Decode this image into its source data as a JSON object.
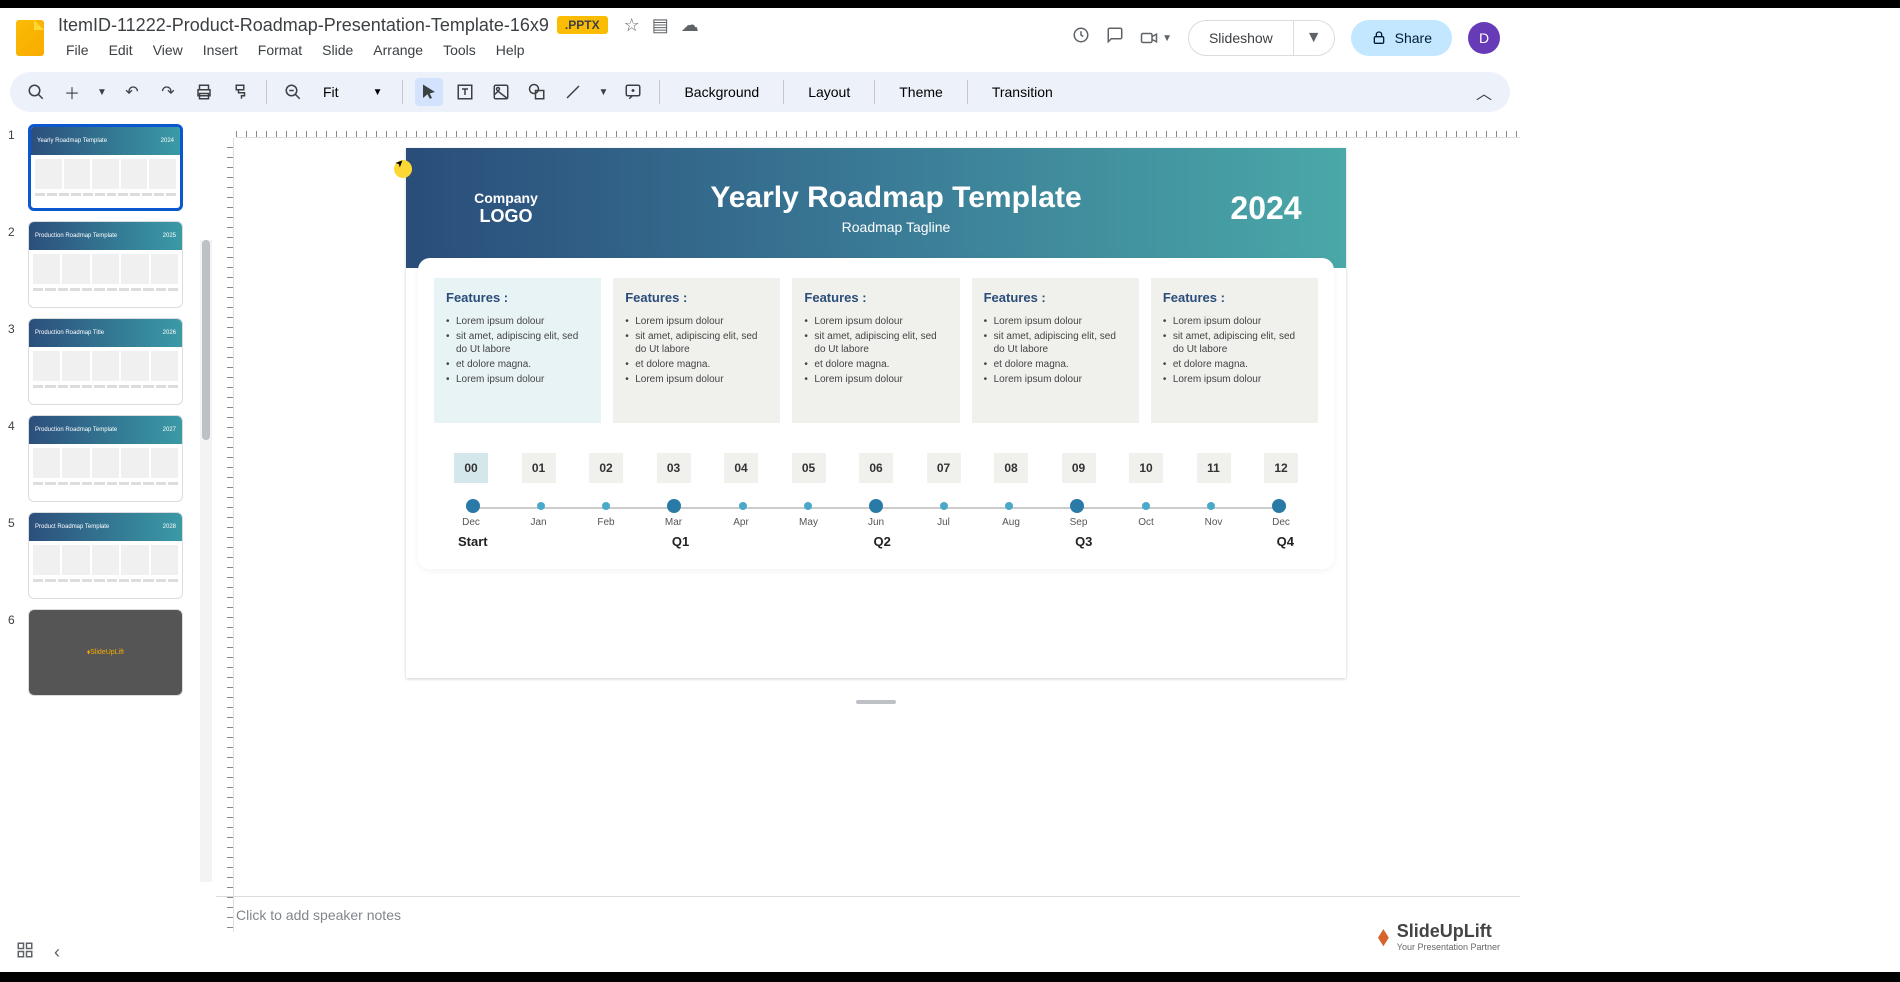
{
  "header": {
    "title": "ItemID-11222-Product-Roadmap-Presentation-Template-16x9",
    "badge": ".PPTX",
    "menus": [
      "File",
      "Edit",
      "View",
      "Insert",
      "Format",
      "Slide",
      "Arrange",
      "Tools",
      "Help"
    ],
    "slideshow": "Slideshow",
    "share": "Share",
    "avatar": "D"
  },
  "toolbar": {
    "zoom": "Fit",
    "background": "Background",
    "layout": "Layout",
    "theme": "Theme",
    "transition": "Transition"
  },
  "slides": {
    "count": 6,
    "titles": [
      "Yearly Roadmap Template",
      "Production Roadmap Template",
      "Production Roadmap Title",
      "Production Roadmap Template",
      "Product Roadmap Template",
      "SlideUpLift"
    ],
    "years": [
      "2024",
      "2025",
      "2026",
      "2027",
      "2028",
      ""
    ]
  },
  "slide": {
    "company": "Company",
    "logo": "LOGO",
    "title": "Yearly Roadmap Template",
    "tagline": "Roadmap Tagline",
    "year": "2024",
    "features_title": "Features :",
    "features": [
      "Lorem ipsum dolour",
      "sit amet, adipiscing elit, sed do Ut labore",
      "et dolore magna.",
      "Lorem ipsum dolour"
    ],
    "months_num": [
      "00",
      "01",
      "02",
      "03",
      "04",
      "05",
      "06",
      "07",
      "08",
      "09",
      "10",
      "11",
      "12"
    ],
    "months": [
      "Dec",
      "Jan",
      "Feb",
      "Mar",
      "Apr",
      "May",
      "Jun",
      "Jul",
      "Aug",
      "Sep",
      "Oct",
      "Nov",
      "Dec"
    ],
    "quarters": [
      "Start",
      "Q1",
      "Q2",
      "Q3",
      "Q4"
    ]
  },
  "notes": "Click to add speaker notes",
  "watermark": {
    "title": "SlideUpLift",
    "sub": "Your Presentation Partner"
  }
}
